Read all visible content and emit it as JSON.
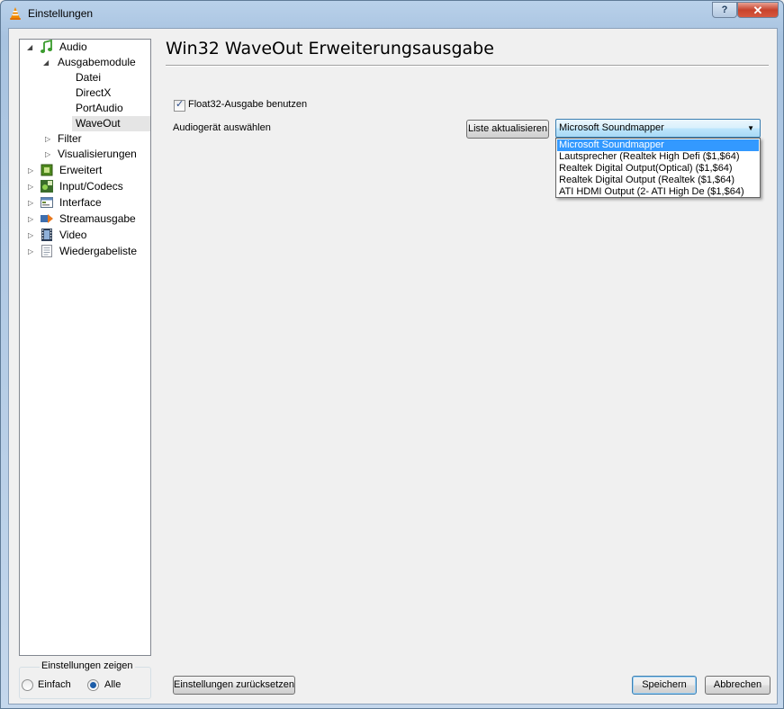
{
  "window": {
    "title": "Einstellungen",
    "help_label": "?",
    "close_label": "✕"
  },
  "tree": {
    "items": [
      {
        "label": "Audio",
        "icon": "music-note-icon"
      },
      {
        "label": "Ausgabemodule"
      },
      {
        "label": "Datei"
      },
      {
        "label": "DirectX"
      },
      {
        "label": "PortAudio"
      },
      {
        "label": "WaveOut"
      },
      {
        "label": "Filter"
      },
      {
        "label": "Visualisierungen"
      },
      {
        "label": "Erweitert",
        "icon": "chip-icon"
      },
      {
        "label": "Input/Codecs",
        "icon": "codec-icon"
      },
      {
        "label": "Interface",
        "icon": "interface-icon"
      },
      {
        "label": "Streamausgabe",
        "icon": "stream-icon"
      },
      {
        "label": "Video",
        "icon": "film-icon"
      },
      {
        "label": "Wiedergabeliste",
        "icon": "playlist-icon"
      }
    ]
  },
  "show_settings": {
    "title": "Einstellungen zeigen",
    "simple_label": "Einfach",
    "all_label": "Alle",
    "selected": "Alle"
  },
  "panel": {
    "heading": "Win32 WaveOut Erweiterungsausgabe",
    "float32_label": "Float32-Ausgabe benutzen",
    "float32_checked": true,
    "device_label": "Audiogerät auswählen",
    "refresh_button": "Liste aktualisieren",
    "device_value": "Microsoft Soundmapper",
    "device_options": [
      "Microsoft Soundmapper",
      "Lautsprecher (Realtek High Defi ($1,$64)",
      "Realtek Digital Output(Optical) ($1,$64)",
      "Realtek Digital Output (Realtek ($1,$64)",
      "ATI HDMI Output (2- ATI High De ($1,$64)"
    ]
  },
  "footer": {
    "reset_button": "Einstellungen zurücksetzen",
    "save_button": "Speichern",
    "cancel_button": "Abbrechen"
  },
  "colors": {
    "selection": "#3399ff",
    "title_bar": "#b9d1ea",
    "close_button": "#c7432d"
  }
}
